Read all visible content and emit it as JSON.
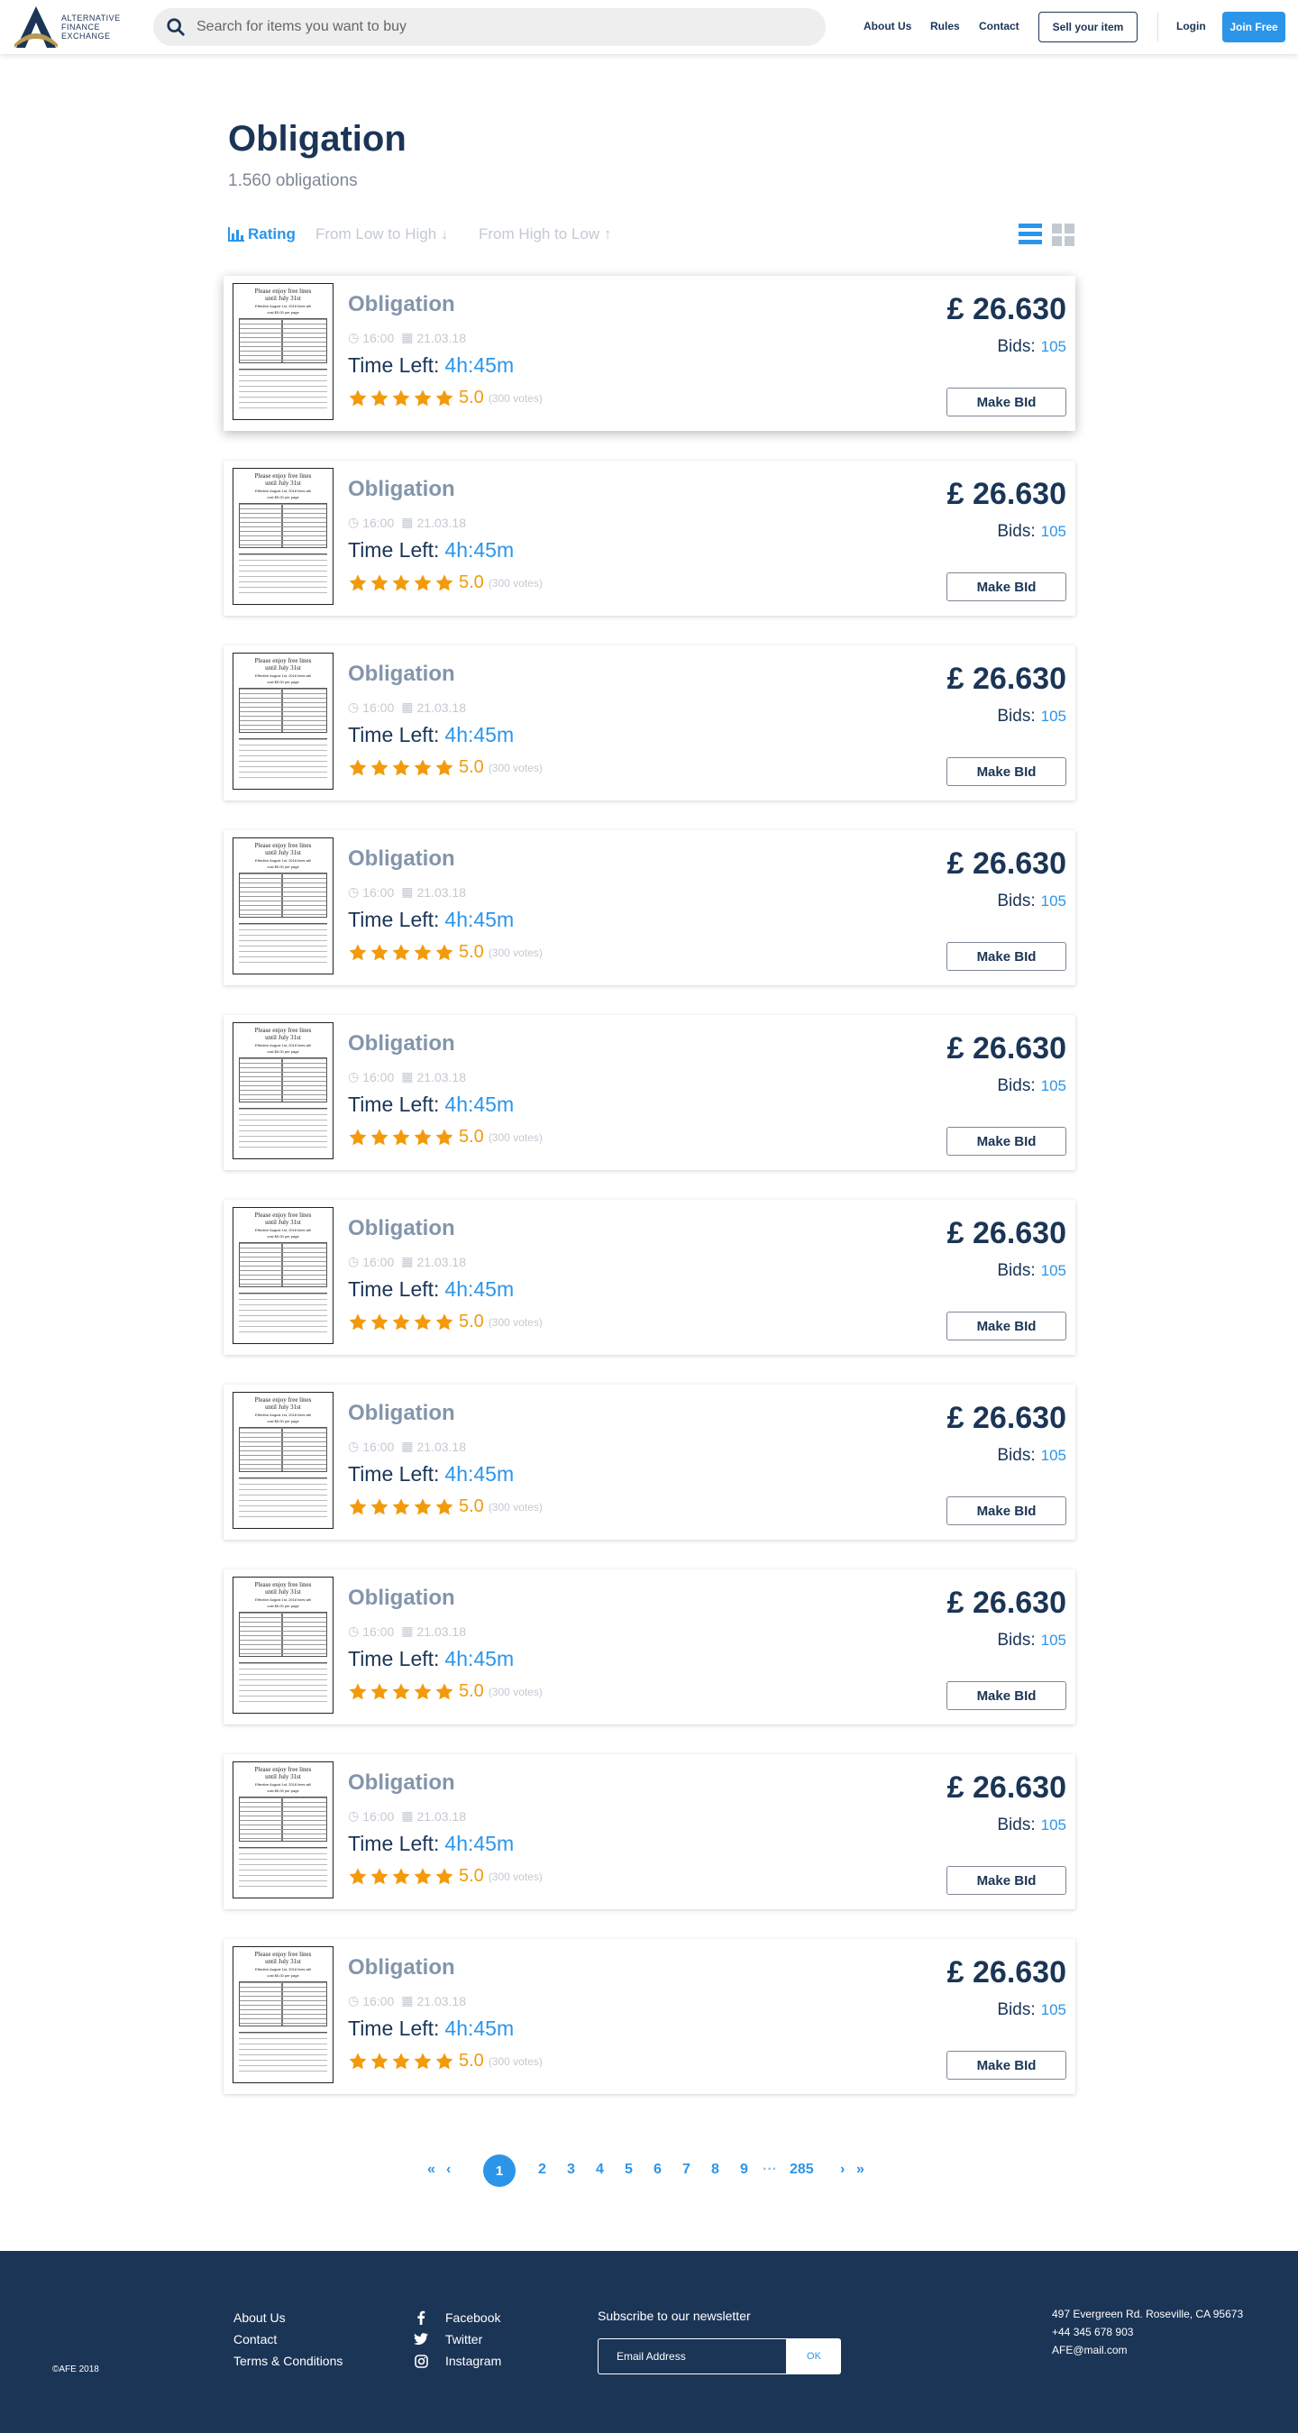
{
  "header": {
    "logo_lines": [
      "ALTERNATIVE",
      "FINANCE",
      "EXCHANGE"
    ],
    "search_placeholder": "Search for items you want to buy",
    "nav": [
      "About Us",
      "Rules",
      "Contact"
    ],
    "sell_label": "Sell your item",
    "login_label": "Login",
    "join_label": "Join Free"
  },
  "page": {
    "title": "Obligation",
    "count": "1.560 obligations"
  },
  "sort": {
    "rating": "Rating",
    "low_high": "From Low to High",
    "high_low": "From High to Low"
  },
  "thumbnail": {
    "line1": "Please enjoy free lines",
    "line2": "until July 31st",
    "line3": "Effective August 1st, 2018 lines will",
    "line4": "cost $5.00 per page"
  },
  "listing": {
    "title": "Obligation",
    "time": "16:00",
    "date": "21.03.18",
    "time_left_label": "Time Left:",
    "time_left": "4h:45m",
    "rating": "5.0",
    "stars": 5,
    "votes": "(300 votes)",
    "price": "£ 26.630",
    "bids_label": "Bids:",
    "bids": "105",
    "bid_button": "Make BId"
  },
  "pagination": {
    "current": "1",
    "pages": [
      "2",
      "3",
      "4",
      "5",
      "6",
      "7",
      "8",
      "9"
    ],
    "ellipsis": "···",
    "last": "285"
  },
  "footer": {
    "copyright": "©AFE 2018",
    "links": [
      "About Us",
      "Contact",
      "Terms & Conditions"
    ],
    "social": [
      "Facebook",
      "Twitter",
      "Instagram"
    ],
    "newsletter_title": "Subscribe to our newsletter",
    "email_placeholder": "Email Address",
    "ok_label": "OK",
    "address": "497 Evergreen Rd. Roseville, CA 95673",
    "phone": "+44 345 678 903",
    "email": "AFE@mail.com"
  },
  "colors": {
    "navy": "#1b3556",
    "accent_blue": "#2b95ea",
    "star_orange": "#f39a0b",
    "muted": "#c3c9d1"
  }
}
